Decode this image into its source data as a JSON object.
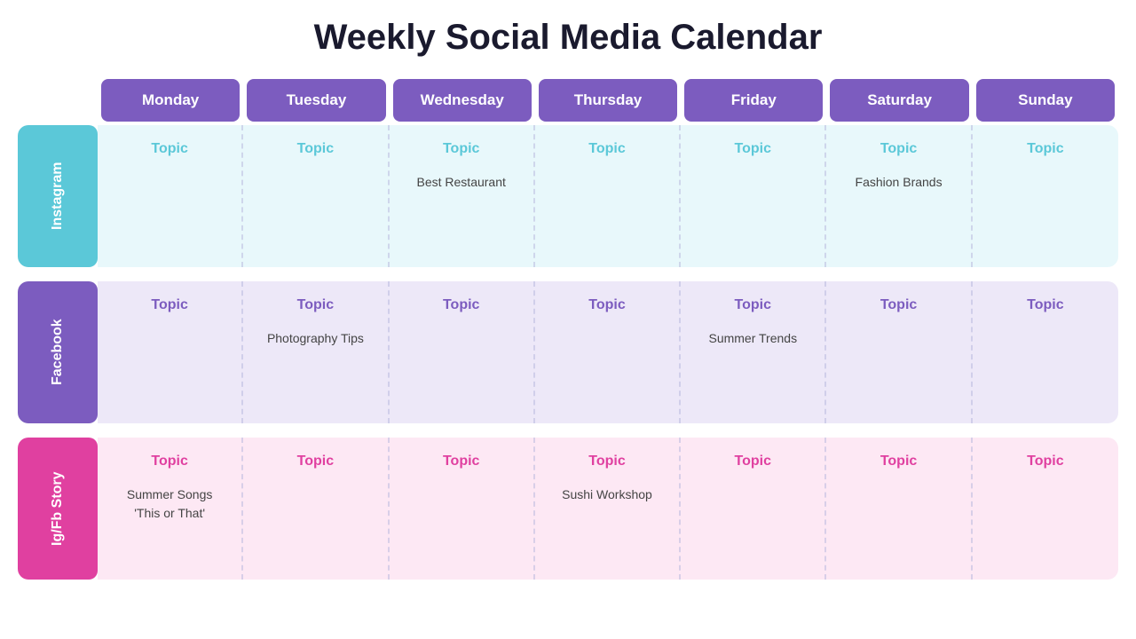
{
  "title": "Weekly Social Media Calendar",
  "days": [
    "Monday",
    "Tuesday",
    "Wednesday",
    "Thursday",
    "Friday",
    "Saturday",
    "Sunday"
  ],
  "sections": [
    {
      "id": "instagram",
      "label": "Instagram",
      "colorClass": "instagram",
      "bgClass": "instagram-bg",
      "topicClass": "instagram-topic",
      "cells": [
        {
          "topic": "Topic",
          "content": ""
        },
        {
          "topic": "Topic",
          "content": ""
        },
        {
          "topic": "Topic",
          "content": "Best Restaurant"
        },
        {
          "topic": "Topic",
          "content": ""
        },
        {
          "topic": "Topic",
          "content": ""
        },
        {
          "topic": "Topic",
          "content": "Fashion Brands"
        },
        {
          "topic": "Topic",
          "content": ""
        }
      ]
    },
    {
      "id": "facebook",
      "label": "Facebook",
      "colorClass": "facebook",
      "bgClass": "facebook-bg",
      "topicClass": "facebook-topic",
      "cells": [
        {
          "topic": "Topic",
          "content": ""
        },
        {
          "topic": "Topic",
          "content": "Photography Tips"
        },
        {
          "topic": "Topic",
          "content": ""
        },
        {
          "topic": "Topic",
          "content": ""
        },
        {
          "topic": "Topic",
          "content": "Summer Trends"
        },
        {
          "topic": "Topic",
          "content": ""
        },
        {
          "topic": "Topic",
          "content": ""
        }
      ]
    },
    {
      "id": "igfb",
      "label": "Ig/Fb Story",
      "colorClass": "igfb",
      "bgClass": "igfb-bg",
      "topicClass": "igfb-topic",
      "cells": [
        {
          "topic": "Topic",
          "content": "Summer Songs\n'This or That'"
        },
        {
          "topic": "Topic",
          "content": ""
        },
        {
          "topic": "Topic",
          "content": ""
        },
        {
          "topic": "Topic",
          "content": "Sushi Workshop"
        },
        {
          "topic": "Topic",
          "content": ""
        },
        {
          "topic": "Topic",
          "content": ""
        },
        {
          "topic": "Topic",
          "content": ""
        }
      ]
    }
  ]
}
